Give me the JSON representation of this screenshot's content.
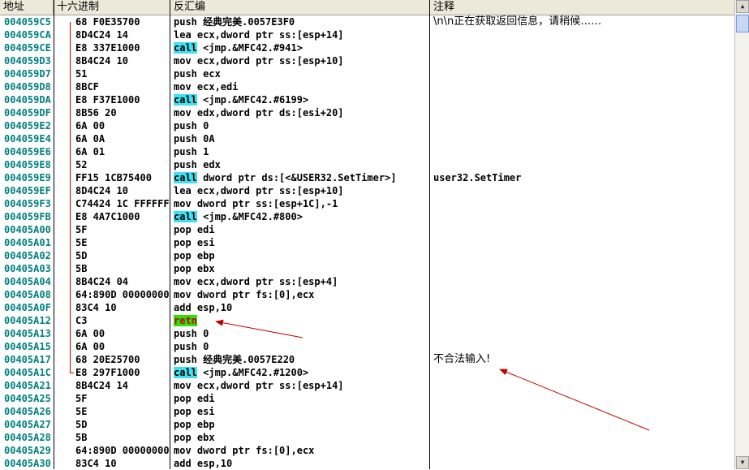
{
  "columns": [
    "地址",
    "十六进制",
    "反汇编",
    "注释"
  ],
  "rows": [
    {
      "addr": "004059C5",
      "hex": "68 F0E35700",
      "pre": "",
      "kw": "",
      "post": "push 经典完美.0057E3F0",
      "comment": "\\n\\n正在获取返回信息，请稍候……"
    },
    {
      "addr": "004059CA",
      "hex": "8D4C24 14",
      "pre": "",
      "kw": "",
      "post": "lea ecx,dword ptr ss:[esp+14]",
      "comment": ""
    },
    {
      "addr": "004059CE",
      "hex": "E8 337E1000",
      "pre": "",
      "kw": "call",
      "post": " <jmp.&MFC42.#941>",
      "comment": ""
    },
    {
      "addr": "004059D3",
      "hex": "8B4C24 10",
      "pre": "",
      "kw": "",
      "post": "mov ecx,dword ptr ss:[esp+10]",
      "comment": ""
    },
    {
      "addr": "004059D7",
      "hex": "51",
      "pre": "",
      "kw": "",
      "post": "push ecx",
      "comment": ""
    },
    {
      "addr": "004059D8",
      "hex": "8BCF",
      "pre": "",
      "kw": "",
      "post": "mov ecx,edi",
      "comment": ""
    },
    {
      "addr": "004059DA",
      "hex": "E8 F37E1000",
      "pre": "",
      "kw": "call",
      "post": " <jmp.&MFC42.#6199>",
      "comment": ""
    },
    {
      "addr": "004059DF",
      "hex": "8B56 20",
      "pre": "",
      "kw": "",
      "post": "mov edx,dword ptr ds:[esi+20]",
      "comment": ""
    },
    {
      "addr": "004059E2",
      "hex": "6A 00",
      "pre": "",
      "kw": "",
      "post": "push 0",
      "comment": ""
    },
    {
      "addr": "004059E4",
      "hex": "6A 0A",
      "pre": "",
      "kw": "",
      "post": "push 0A",
      "comment": ""
    },
    {
      "addr": "004059E6",
      "hex": "6A 01",
      "pre": "",
      "kw": "",
      "post": "push 1",
      "comment": ""
    },
    {
      "addr": "004059E8",
      "hex": "52",
      "pre": "",
      "kw": "",
      "post": "push edx",
      "comment": ""
    },
    {
      "addr": "004059E9",
      "hex": "FF15 1CB75400",
      "pre": "",
      "kw": "call",
      "post": " dword ptr ds:[<&USER32.SetTimer>]",
      "comment": "user32.SetTimer"
    },
    {
      "addr": "004059EF",
      "hex": "8D4C24 10",
      "pre": "",
      "kw": "",
      "post": "lea ecx,dword ptr ss:[esp+10]",
      "comment": ""
    },
    {
      "addr": "004059F3",
      "hex": "C74424 1C FFFFFFFF",
      "pre": "",
      "kw": "",
      "post": "mov dword ptr ss:[esp+1C],-1",
      "comment": ""
    },
    {
      "addr": "004059FB",
      "hex": "E8 4A7C1000",
      "pre": "",
      "kw": "call",
      "post": " <jmp.&MFC42.#800>",
      "comment": ""
    },
    {
      "addr": "00405A00",
      "hex": "5F",
      "pre": "",
      "kw": "",
      "post": "pop edi",
      "comment": ""
    },
    {
      "addr": "00405A01",
      "hex": "5E",
      "pre": "",
      "kw": "",
      "post": "pop esi",
      "comment": ""
    },
    {
      "addr": "00405A02",
      "hex": "5D",
      "pre": "",
      "kw": "",
      "post": "pop ebp",
      "comment": ""
    },
    {
      "addr": "00405A03",
      "hex": "5B",
      "pre": "",
      "kw": "",
      "post": "pop ebx",
      "comment": ""
    },
    {
      "addr": "00405A04",
      "hex": "8B4C24 04",
      "pre": "",
      "kw": "",
      "post": "mov ecx,dword ptr ss:[esp+4]",
      "comment": ""
    },
    {
      "addr": "00405A08",
      "hex": "64:890D 00000000",
      "pre": "",
      "kw": "",
      "post": "mov dword ptr fs:[0],ecx",
      "comment": ""
    },
    {
      "addr": "00405A0F",
      "hex": "83C4 10",
      "pre": "",
      "kw": "",
      "post": "add esp,10",
      "comment": ""
    },
    {
      "addr": "00405A12",
      "hex": "C3",
      "pre": "",
      "kw": "retn",
      "post": "",
      "comment": ""
    },
    {
      "addr": "00405A13",
      "hex": "6A 00",
      "pre": "",
      "kw": "",
      "post": "push 0",
      "comment": ""
    },
    {
      "addr": "00405A15",
      "hex": "6A 00",
      "pre": "",
      "kw": "",
      "post": "push 0",
      "comment": ""
    },
    {
      "addr": "00405A17",
      "hex": "68 20E25700",
      "pre": "",
      "kw": "",
      "post": "push 经典完美.0057E220",
      "comment": "不合法输入!"
    },
    {
      "addr": "00405A1C",
      "hex": "E8 297F1000",
      "pre": "",
      "kw": "call",
      "post": " <jmp.&MFC42.#1200>",
      "comment": ""
    },
    {
      "addr": "00405A21",
      "hex": "8B4C24 14",
      "pre": "",
      "kw": "",
      "post": "mov ecx,dword ptr ss:[esp+14]",
      "comment": ""
    },
    {
      "addr": "00405A25",
      "hex": "5F",
      "pre": "",
      "kw": "",
      "post": "pop edi",
      "comment": ""
    },
    {
      "addr": "00405A26",
      "hex": "5E",
      "pre": "",
      "kw": "",
      "post": "pop esi",
      "comment": ""
    },
    {
      "addr": "00405A27",
      "hex": "5D",
      "pre": "",
      "kw": "",
      "post": "pop ebp",
      "comment": ""
    },
    {
      "addr": "00405A28",
      "hex": "5B",
      "pre": "",
      "kw": "",
      "post": "pop ebx",
      "comment": ""
    },
    {
      "addr": "00405A29",
      "hex": "64:890D 00000000",
      "pre": "",
      "kw": "",
      "post": "mov dword ptr fs:[0],ecx",
      "comment": ""
    },
    {
      "addr": "00405A30",
      "hex": "83C4 10",
      "pre": "",
      "kw": "",
      "post": "add esp,10",
      "comment": ""
    }
  ],
  "colors": {
    "call_bg": "#40e0f0",
    "retn_bg": "#2fe000",
    "retn_fg": "#c00000",
    "addr_fg": "#008080",
    "arrow": "#c00000"
  },
  "scrollbar": {
    "up_icon": "scroll-up-icon",
    "down_icon": "scroll-down-icon"
  }
}
